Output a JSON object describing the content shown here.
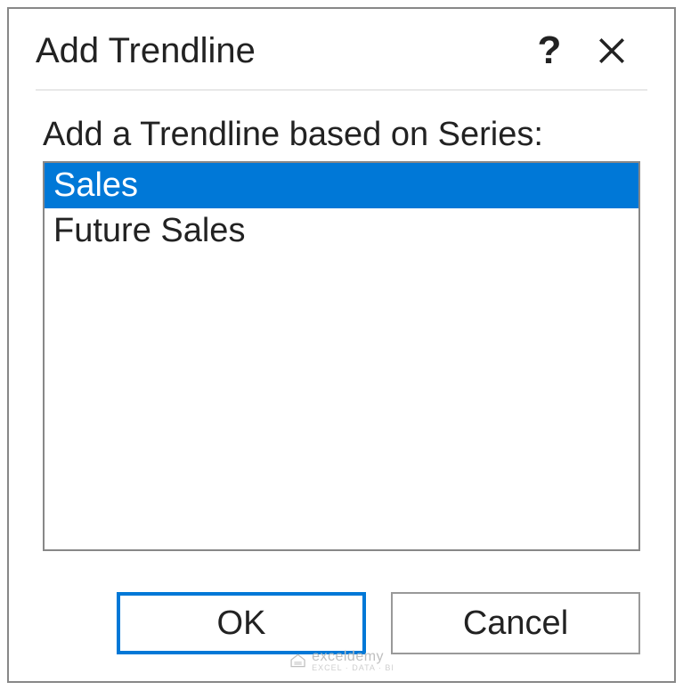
{
  "dialog": {
    "title": "Add Trendline",
    "help_symbol": "?",
    "prompt": "Add a Trendline based on Series:",
    "list_items": [
      {
        "label": "Sales",
        "selected": true
      },
      {
        "label": "Future Sales",
        "selected": false
      }
    ],
    "ok_label": "OK",
    "cancel_label": "Cancel"
  },
  "watermark": {
    "text": "exceldemy",
    "sub": "EXCEL · DATA · BI"
  }
}
